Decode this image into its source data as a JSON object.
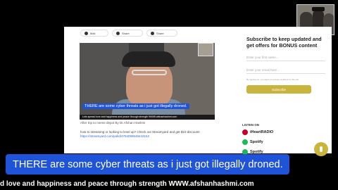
{
  "share": {
    "btn1": "Mail",
    "btn2": "Share",
    "btn3": "Share"
  },
  "video": {
    "caption": "THERE are some cyber threats as i just got illegally droned.",
    "ticker": "Lets spread love and happiness and peace through strength WWW.afshanhashmi.com"
  },
  "post": {
    "after_text": "After trip to meme depot By Dr.Afshan Hashmi",
    "promo_text": "how to streaming or looking to level up? Check out Streamyard and get $10 discount!",
    "promo_link": "https://streamyard.com/pal/d/4784099648443152"
  },
  "signup": {
    "title": "Subscribe to keep updated and get offers for BONUS content",
    "first_name_placeholder": "Enter your first name...",
    "email_placeholder": "Enter your email here...",
    "fine_print": "By signing up, you agree to receive emails from this site.",
    "button": "Subscribe"
  },
  "listen": {
    "heading": "LISTEN ON",
    "platforms": [
      "iHeartRADIO",
      "Spotify",
      "Spotify"
    ]
  },
  "overlay": {
    "caption": "THERE are some cyber threats as i just got illegally droned.",
    "ticker": "d love and happiness and peace through strength WWW.afshanhashmi.com"
  },
  "icons": [
    "mail-icon",
    "share-icon",
    "microphone-icon",
    "iheartradio-logo",
    "spotify-logo"
  ],
  "colors": {
    "caption_blue": "#1f54d8",
    "subscribe_gold": "#c9b43e"
  }
}
